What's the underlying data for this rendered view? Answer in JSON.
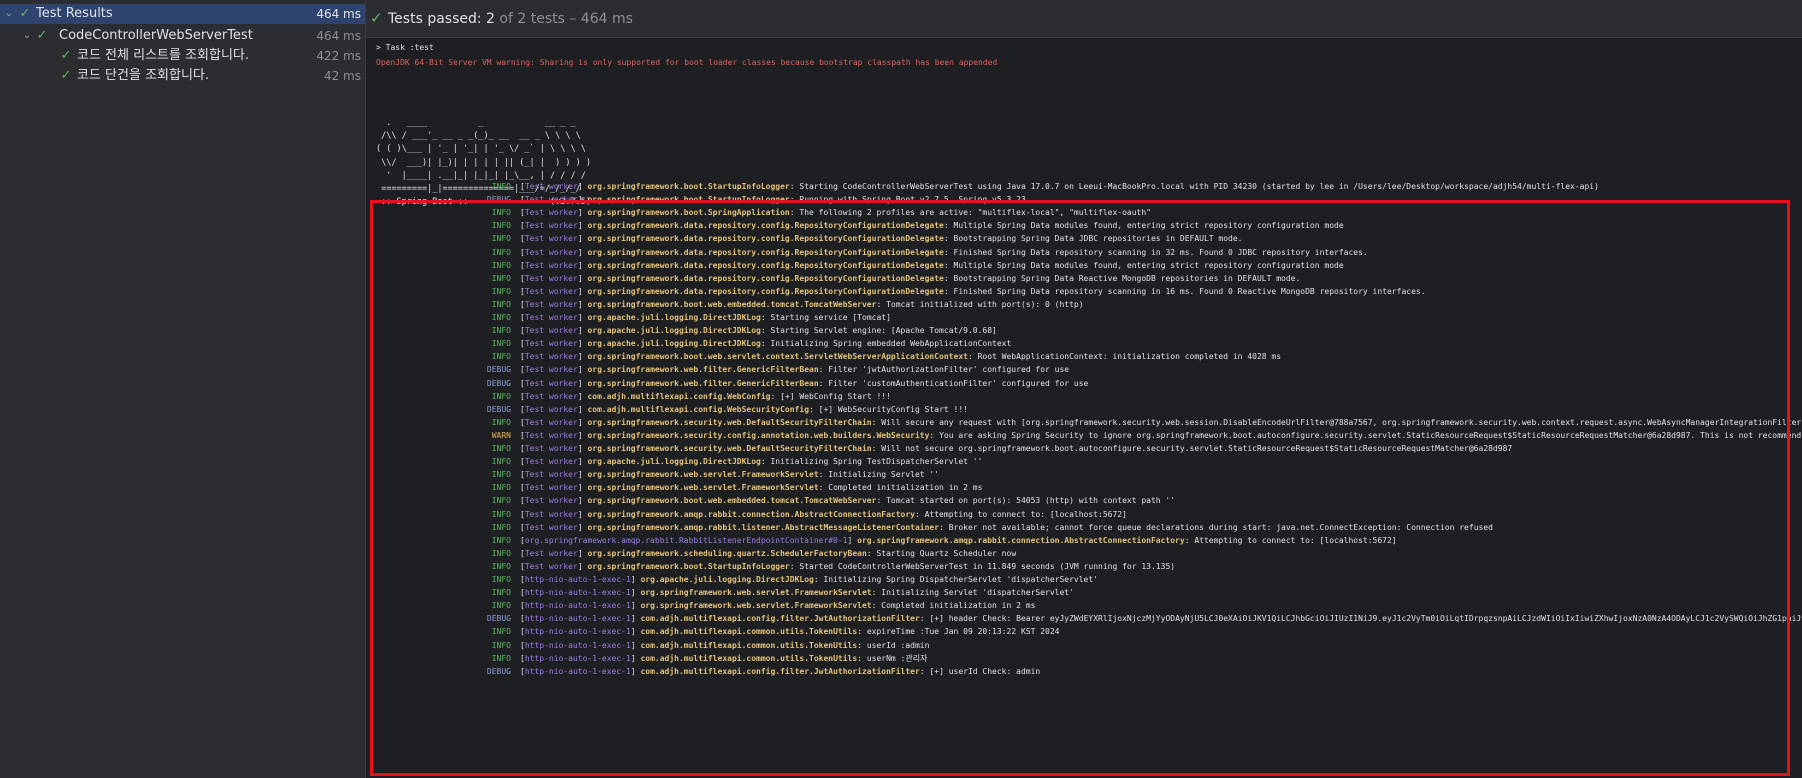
{
  "tree": {
    "root": {
      "label": "Test Results",
      "duration": "464 ms"
    },
    "suite": {
      "label": "CodeControllerWebServerTest",
      "duration": "464 ms"
    },
    "tests": [
      {
        "label": "코드 전체 리스트를 조회합니다.",
        "duration": "422 ms"
      },
      {
        "label": "코드 단건을 조회합니다.",
        "duration": "42 ms"
      }
    ]
  },
  "header": {
    "passed_label": "Tests passed:",
    "passed_count": "2",
    "of_text": "of 2 tests – 464 ms"
  },
  "console": {
    "task_line": "> Task :test",
    "jvm_warning": "OpenJDK 64-Bit Server VM warning: Sharing is only supported for boot loader classes because bootstrap classpath has been appended",
    "banner": [
      "  .   ____          _            __ _ _",
      " /\\\\ / ___'_ __ _ _(_)_ __  __ _ \\ \\ \\ \\",
      "( ( )\\___ | '_ | '_| | '_ \\/ _` | \\ \\ \\ \\",
      " \\\\/  ___)| |_)| | | | | || (_| |  ) ) ) )",
      "  '  |____| .__|_| |_|_| |_\\__, | / / / /",
      " =========|_|==============|___/=/_/_/_/",
      " :: Spring Boot ::                (v2.7.5)"
    ],
    "logs": [
      {
        "level": "INFO",
        "thread": "Test worker",
        "logger": "org.springframework.boot.StartupInfoLogger",
        "message": "Starting CodeControllerWebServerTest using Java 17.0.7 on Leeui-MacBookPro.local with PID 34230 (started by lee in /Users/lee/Desktop/workspace/adjh54/multi-flex-api)"
      },
      {
        "level": "DEBUG",
        "thread": "Test worker",
        "logger": "org.springframework.boot.StartupInfoLogger",
        "message": "Running with Spring Boot v2.7.5, Spring v5.3.23"
      },
      {
        "level": "INFO",
        "thread": "Test worker",
        "logger": "org.springframework.boot.SpringApplication",
        "message": "The following 2 profiles are active: \"multiflex-local\", \"multiflex-oauth\""
      },
      {
        "level": "INFO",
        "thread": "Test worker",
        "logger": "org.springframework.data.repository.config.RepositoryConfigurationDelegate",
        "message": "Multiple Spring Data modules found, entering strict repository configuration mode"
      },
      {
        "level": "INFO",
        "thread": "Test worker",
        "logger": "org.springframework.data.repository.config.RepositoryConfigurationDelegate",
        "message": "Bootstrapping Spring Data JDBC repositories in DEFAULT mode."
      },
      {
        "level": "INFO",
        "thread": "Test worker",
        "logger": "org.springframework.data.repository.config.RepositoryConfigurationDelegate",
        "message": "Finished Spring Data repository scanning in 32 ms. Found 0 JDBC repository interfaces."
      },
      {
        "level": "INFO",
        "thread": "Test worker",
        "logger": "org.springframework.data.repository.config.RepositoryConfigurationDelegate",
        "message": "Multiple Spring Data modules found, entering strict repository configuration mode"
      },
      {
        "level": "INFO",
        "thread": "Test worker",
        "logger": "org.springframework.data.repository.config.RepositoryConfigurationDelegate",
        "message": "Bootstrapping Spring Data Reactive MongoDB repositories in DEFAULT mode."
      },
      {
        "level": "INFO",
        "thread": "Test worker",
        "logger": "org.springframework.data.repository.config.RepositoryConfigurationDelegate",
        "message": "Finished Spring Data repository scanning in 16 ms. Found 0 Reactive MongoDB repository interfaces."
      },
      {
        "level": "INFO",
        "thread": "Test worker",
        "logger": "org.springframework.boot.web.embedded.tomcat.TomcatWebServer",
        "message": "Tomcat initialized with port(s): 0 (http)"
      },
      {
        "level": "INFO",
        "thread": "Test worker",
        "logger": "org.apache.juli.logging.DirectJDKLog",
        "message": "Starting service [Tomcat]"
      },
      {
        "level": "INFO",
        "thread": "Test worker",
        "logger": "org.apache.juli.logging.DirectJDKLog",
        "message": "Starting Servlet engine: [Apache Tomcat/9.0.68]"
      },
      {
        "level": "INFO",
        "thread": "Test worker",
        "logger": "org.apache.juli.logging.DirectJDKLog",
        "message": "Initializing Spring embedded WebApplicationContext"
      },
      {
        "level": "INFO",
        "thread": "Test worker",
        "logger": "org.springframework.boot.web.servlet.context.ServletWebServerApplicationContext",
        "message": "Root WebApplicationContext: initialization completed in 4028 ms"
      },
      {
        "level": "DEBUG",
        "thread": "Test worker",
        "logger": "org.springframework.web.filter.GenericFilterBean",
        "message": "Filter 'jwtAuthorizationFilter' configured for use"
      },
      {
        "level": "DEBUG",
        "thread": "Test worker",
        "logger": "org.springframework.web.filter.GenericFilterBean",
        "message": "Filter 'customAuthenticationFilter' configured for use"
      },
      {
        "level": "INFO",
        "thread": "Test worker",
        "logger": "com.adjh.multiflexapi.config.WebConfig",
        "message": "[+] WebConfig Start !!!"
      },
      {
        "level": "DEBUG",
        "thread": "Test worker",
        "logger": "com.adjh.multiflexapi.config.WebSecurityConfig",
        "message": "[+] WebSecurityConfig Start !!!"
      },
      {
        "level": "INFO",
        "thread": "Test worker",
        "logger": "org.springframework.security.web.DefaultSecurityFilterChain",
        "message": "Will secure any request with [org.springframework.security.web.session.DisableEncodeUrlFilter@788a7567, org.springframework.security.web.context.request.async.WebAsyncManagerIntegrationFilter"
      },
      {
        "level": "WARN",
        "thread": "Test worker",
        "logger": "org.springframework.security.config.annotation.web.builders.WebSecurity",
        "message": "You are asking Spring Security to ignore org.springframework.boot.autoconfigure.security.servlet.StaticResourceRequest$StaticResourceRequestMatcher@6a28d987. This is not recommend"
      },
      {
        "level": "INFO",
        "thread": "Test worker",
        "logger": "org.springframework.security.web.DefaultSecurityFilterChain",
        "message": "Will not secure org.springframework.boot.autoconfigure.security.servlet.StaticResourceRequest$StaticResourceRequestMatcher@6a28d987"
      },
      {
        "level": "INFO",
        "thread": "Test worker",
        "logger": "org.apache.juli.logging.DirectJDKLog",
        "message": "Initializing Spring TestDispatcherServlet ''"
      },
      {
        "level": "INFO",
        "thread": "Test worker",
        "logger": "org.springframework.web.servlet.FrameworkServlet",
        "message": "Initializing Servlet ''"
      },
      {
        "level": "INFO",
        "thread": "Test worker",
        "logger": "org.springframework.web.servlet.FrameworkServlet",
        "message": "Completed initialization in 2 ms"
      },
      {
        "level": "INFO",
        "thread": "Test worker",
        "logger": "org.springframework.boot.web.embedded.tomcat.TomcatWebServer",
        "message": "Tomcat started on port(s): 54053 (http) with context path ''"
      },
      {
        "level": "INFO",
        "thread": "Test worker",
        "logger": "org.springframework.amqp.rabbit.connection.AbstractConnectionFactory",
        "message": "Attempting to connect to: [localhost:5672]"
      },
      {
        "level": "INFO",
        "thread": "Test worker",
        "logger": "org.springframework.amqp.rabbit.listener.AbstractMessageListenerContainer",
        "message": "Broker not available; cannot force queue declarations during start: java.net.ConnectException: Connection refused"
      },
      {
        "level": "INFO",
        "thread": "org.springframework.amqp.rabbit.RabbitListenerEndpointContainer#0-1",
        "logger": "org.springframework.amqp.rabbit.connection.AbstractConnectionFactory",
        "message": "Attempting to connect to: [localhost:5672]"
      },
      {
        "level": "INFO",
        "thread": "Test worker",
        "logger": "org.springframework.scheduling.quartz.SchedulerFactoryBean",
        "message": "Starting Quartz Scheduler now"
      },
      {
        "level": "INFO",
        "thread": "Test worker",
        "logger": "org.springframework.boot.StartupInfoLogger",
        "message": "Started CodeControllerWebServerTest in 11.849 seconds (JVM running for 13.135)"
      },
      {
        "level": "INFO",
        "thread": "http-nio-auto-1-exec-1",
        "logger": "org.apache.juli.logging.DirectJDKLog",
        "message": "Initializing Spring DispatcherServlet 'dispatcherServlet'"
      },
      {
        "level": "INFO",
        "thread": "http-nio-auto-1-exec-1",
        "logger": "org.springframework.web.servlet.FrameworkServlet",
        "message": "Initializing Servlet 'dispatcherServlet'"
      },
      {
        "level": "INFO",
        "thread": "http-nio-auto-1-exec-1",
        "logger": "org.springframework.web.servlet.FrameworkServlet",
        "message": "Completed initialization in 2 ms"
      },
      {
        "level": "DEBUG",
        "thread": "http-nio-auto-1-exec-1",
        "logger": "com.adjh.multiflexapi.config.filter.JwtAuthorizationFilter",
        "message": "[+] header Check: Bearer eyJyZWdEYXRlIjoxNjczMjYyODAyNjU5LCJ0eXAiOiJKV1QiLCJhbGciOiJIUzI1NiJ9.eyJ1c2VyTm0iOiLqtIDrpqzsnpAiLCJzdWIiOiIxIiwiZXhwIjoxNzA0NzA4ODAyLCJ1c2VySWQiOiJhZG1pbiJ9"
      },
      {
        "level": "INFO",
        "thread": "http-nio-auto-1-exec-1",
        "logger": "com.adjh.multiflexapi.common.utils.TokenUtils",
        "message": "expireTime :Tue Jan 09 20:13:22 KST 2024"
      },
      {
        "level": "INFO",
        "thread": "http-nio-auto-1-exec-1",
        "logger": "com.adjh.multiflexapi.common.utils.TokenUtils",
        "message": "userId :admin"
      },
      {
        "level": "INFO",
        "thread": "http-nio-auto-1-exec-1",
        "logger": "com.adjh.multiflexapi.common.utils.TokenUtils",
        "message": "userNm :관리자"
      },
      {
        "level": "DEBUG",
        "thread": "http-nio-auto-1-exec-1",
        "logger": "com.adjh.multiflexapi.config.filter.JwtAuthorizationFilter",
        "message": "[+] userId Check: admin"
      }
    ]
  },
  "colors": {
    "pass_green": "#5fb865",
    "info": "#5fb865",
    "debug": "#8a9fd8",
    "warn": "#e0b15a",
    "thread": "#9c7ee8",
    "logger": "#e2c27a",
    "highlight_box": "#e8101a",
    "jvm_warning": "#e0605a"
  },
  "icons": {
    "expand": "chevron-down-icon",
    "pass": "check-icon"
  }
}
